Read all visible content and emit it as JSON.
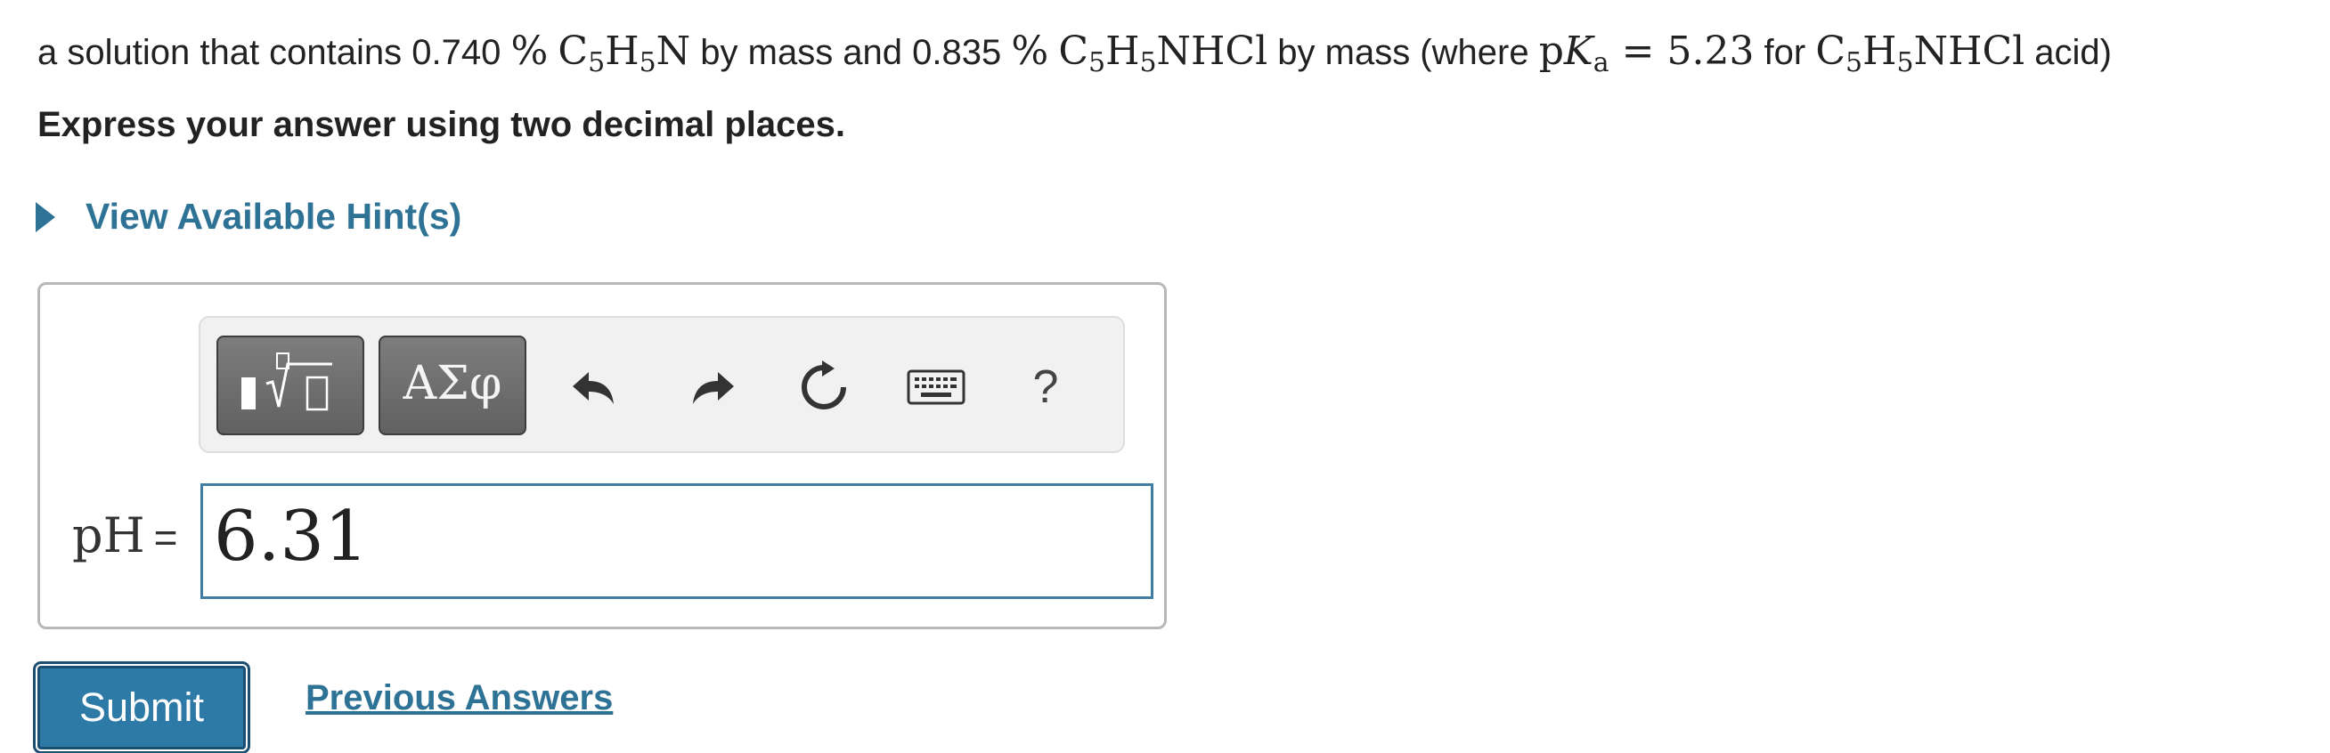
{
  "problem": {
    "t1": "a solution that contains 0.740 ",
    "pct1": "%",
    "c5": "C",
    "sub5": "5",
    "h": "H",
    "sub5b": "5",
    "n": "N",
    "t2": " by mass and 0.835 ",
    "pct2": "%",
    "c5b": "C",
    "sub5c": "5",
    "hb": "H",
    "sub5d": "5",
    "nhcl": "NHCl",
    "t3": " by mass (where ",
    "pka_p": "p",
    "pka_k": "K",
    "pka_sub": "a",
    "pka_eq": " = 5.23",
    "t4": " for ",
    "c5c": "C",
    "sub5e": "5",
    "hc": "H",
    "sub5f": "5",
    "nhcl2": "NHCl",
    "t5": " acid)"
  },
  "instruction": "Express your answer using two decimal places.",
  "hint": {
    "label": "View Available Hint(s)"
  },
  "toolbar": {
    "symbols_label": "ΑΣφ",
    "help_label": "?"
  },
  "answer": {
    "label_ph": "pH",
    "label_eq": "=",
    "value": "6.31"
  },
  "actions": {
    "submit_label": "Submit",
    "previous_answers_label": "Previous Answers"
  },
  "colors": {
    "link": "#2e7396",
    "submit_bg": "#2e7aa6",
    "input_border": "#3d7ea1",
    "toolbar_button": "#6e6e6e"
  }
}
